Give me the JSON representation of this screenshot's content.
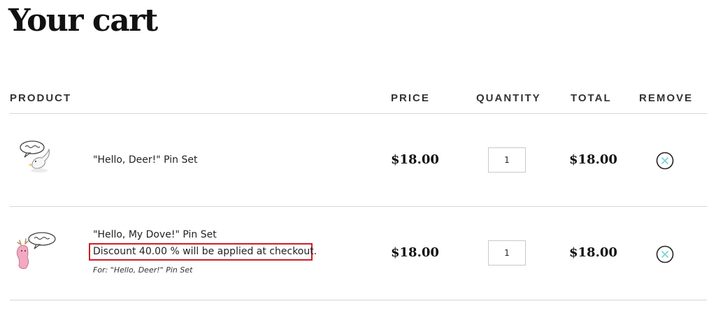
{
  "page": {
    "title": "Your cart"
  },
  "table": {
    "headers": {
      "product": "PRODUCT",
      "price": "PRICE",
      "quantity": "QUANTITY",
      "total": "TOTAL",
      "remove": "REMOVE"
    }
  },
  "items": [
    {
      "name": "\"Hello, Deer!\" Pin Set",
      "price": "$18.00",
      "quantity": "1",
      "total": "$18.00",
      "thumb_icon": "dove-pin-icon"
    },
    {
      "name": "\"Hello, My Dove!\" Pin Set",
      "discount_note": "Discount 40.00 % will be applied at checkout.",
      "for_note": "For: \"Hello, Deer!\" Pin Set",
      "price": "$18.00",
      "quantity": "1",
      "total": "$18.00",
      "thumb_icon": "deer-pin-icon"
    }
  ],
  "colors": {
    "highlight_border": "#cc1f25",
    "remove_icon": "#7fd3d8"
  }
}
